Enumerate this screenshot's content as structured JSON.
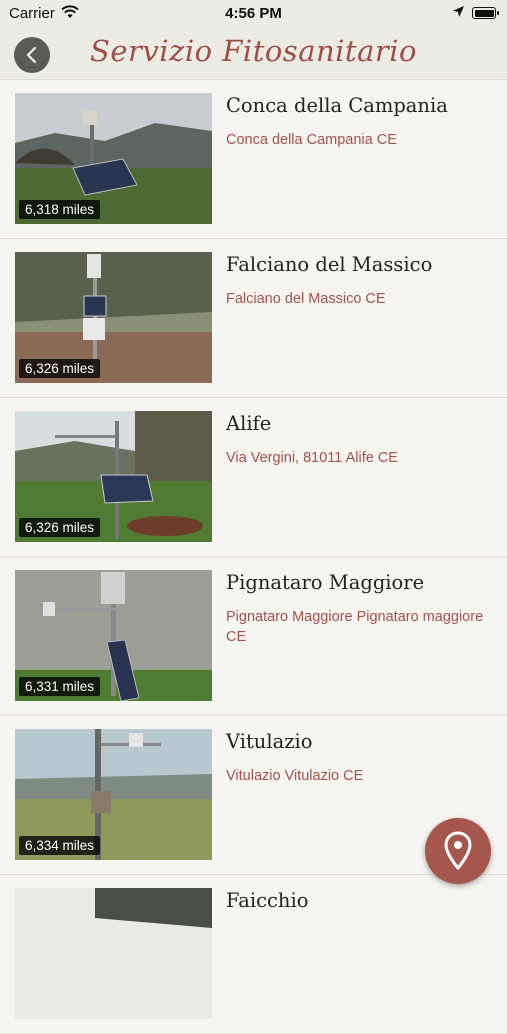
{
  "status_bar": {
    "carrier": "Carrier",
    "time": "4:56 PM"
  },
  "nav": {
    "title": "Servizio Fitosanitario"
  },
  "colors": {
    "accent": "#a5524a",
    "fab": "#a6574d",
    "background": "#f4f3ef"
  },
  "stations": [
    {
      "name": "Conca della Campania",
      "address": "Conca della Campania CE",
      "distance": "6,318 miles"
    },
    {
      "name": "Falciano del Massico",
      "address": "Falciano del Massico CE",
      "distance": "6,326 miles"
    },
    {
      "name": "Alife",
      "address": "Via Vergini, 81011 Alife CE",
      "distance": "6,326 miles"
    },
    {
      "name": "Pignataro Maggiore",
      "address": "Pignataro Maggiore Pignataro maggiore CE",
      "distance": "6,331 miles"
    },
    {
      "name": "Vitulazio",
      "address": "Vitulazio Vitulazio CE",
      "distance": "6,334 miles"
    },
    {
      "name": "Faicchio",
      "address": "",
      "distance": ""
    }
  ],
  "icons": {
    "back": "chevron-left-icon",
    "map": "map-pin-icon",
    "wifi": "wifi-icon",
    "location": "location-arrow-icon",
    "battery": "battery-icon"
  }
}
